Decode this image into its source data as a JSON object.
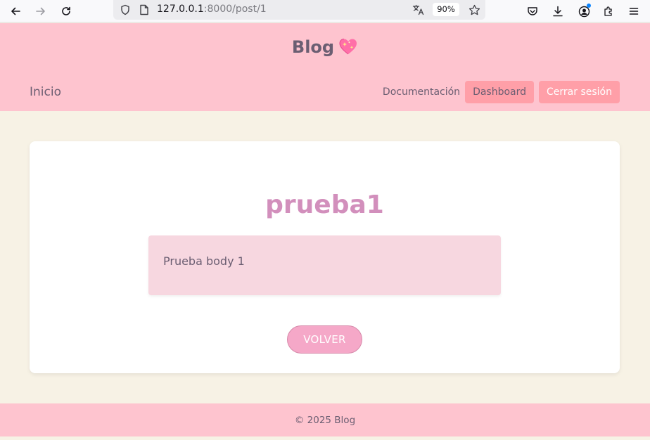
{
  "browser": {
    "url_host": "127.0.0.1",
    "url_path": ":8000/post/1",
    "zoom": "90%",
    "icons": [
      "back-arrow-icon",
      "forward-arrow-icon",
      "reload-icon",
      "shield-icon",
      "page-icon",
      "translate-icon",
      "bookmark-star-icon",
      "pocket-icon",
      "download-icon",
      "account-icon",
      "extensions-icon",
      "menu-icon"
    ]
  },
  "header": {
    "brand": "Blog",
    "brand_emoji": "sparkling-heart-icon",
    "home_link": "Inicio",
    "nav": {
      "docs": "Documentación",
      "dashboard": "Dashboard",
      "logout": "Cerrar sesión"
    }
  },
  "post": {
    "title": "prueba1",
    "body": "Prueba body 1",
    "back_label": "VOLVER"
  },
  "footer": {
    "copyright": "© 2025 Blog"
  },
  "colors": {
    "header_bg": "#fec4cf",
    "page_bg": "#f7f2e5",
    "title_color": "#d28fbc",
    "button_bg": "#f5a8c8",
    "pill_bg": "#ff9fa8",
    "text": "#6b5e72"
  }
}
